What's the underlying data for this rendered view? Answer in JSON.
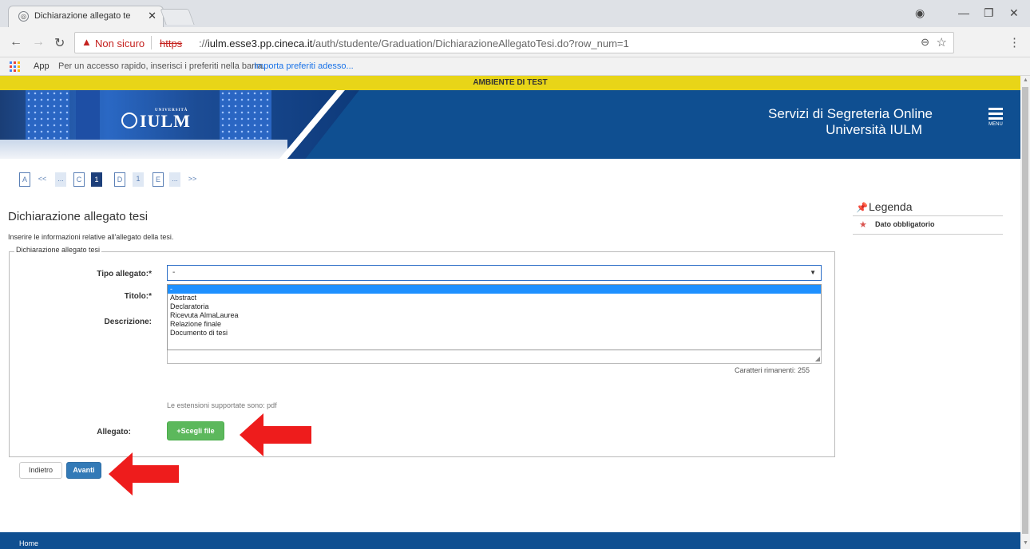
{
  "browser": {
    "tab_title": "Dichiarazione allegato te",
    "tab_close": "✕",
    "favicon": "iulm-favicon-icon",
    "insecure_label": "Non sicuro",
    "url_scheme": "https",
    "url_host": "iulm.esse3.pp.cineca.it",
    "url_path": "/auth/studente/Graduation/DichiarazioneAllegatoTesi.do?row_num=1",
    "bookmarks_apps": "App",
    "bookmarks_hint": "Per un accesso rapido, inserisci i preferiti nella barra.",
    "bookmarks_import": "Importa preferiti adesso..."
  },
  "banner": {
    "test_env": "AMBIENTE DI TEST"
  },
  "header": {
    "logo_text": "IULM",
    "logo_sup": "UNIVERSITÀ",
    "title_line1": "Servizi di Segreteria Online",
    "title_line2": "Università IULM",
    "menu_label": "MENU"
  },
  "steps": [
    "A",
    "<<",
    "...",
    "C",
    "1",
    "D",
    "1",
    "E",
    "...",
    ">>"
  ],
  "main": {
    "title": "Dichiarazione allegato tesi",
    "intro": "Inserire le informazioni relative all'allegato della tesi.",
    "fieldset_legend": "Dichiarazione allegato tesi",
    "label_tipo": "Tipo allegato:*",
    "label_titolo": "Titolo:*",
    "label_descrizione": "Descrizione:",
    "label_allegato": "Allegato:",
    "select_value": "-",
    "options": [
      "-",
      "Abstract",
      "Declaratoria",
      "Ricevuta AlmaLaurea",
      "Relazione finale",
      "Documento di tesi"
    ],
    "chars_remaining": "Caratteri rimanenti: 255",
    "extensions": "Le estensioni supportate sono: pdf",
    "file_button": "+Scegli file",
    "back_button": "Indietro",
    "next_button": "Avanti"
  },
  "legend": {
    "title": "Legenda",
    "item_required": "Dato obbligatorio"
  },
  "footer": {
    "home": "Home"
  },
  "colors": {
    "brand_blue": "#0f4f91",
    "test_yellow": "#e8d518",
    "green_button": "#5cb85c",
    "primary_button": "#337ab7",
    "annotation_red": "#ee1c1c"
  }
}
